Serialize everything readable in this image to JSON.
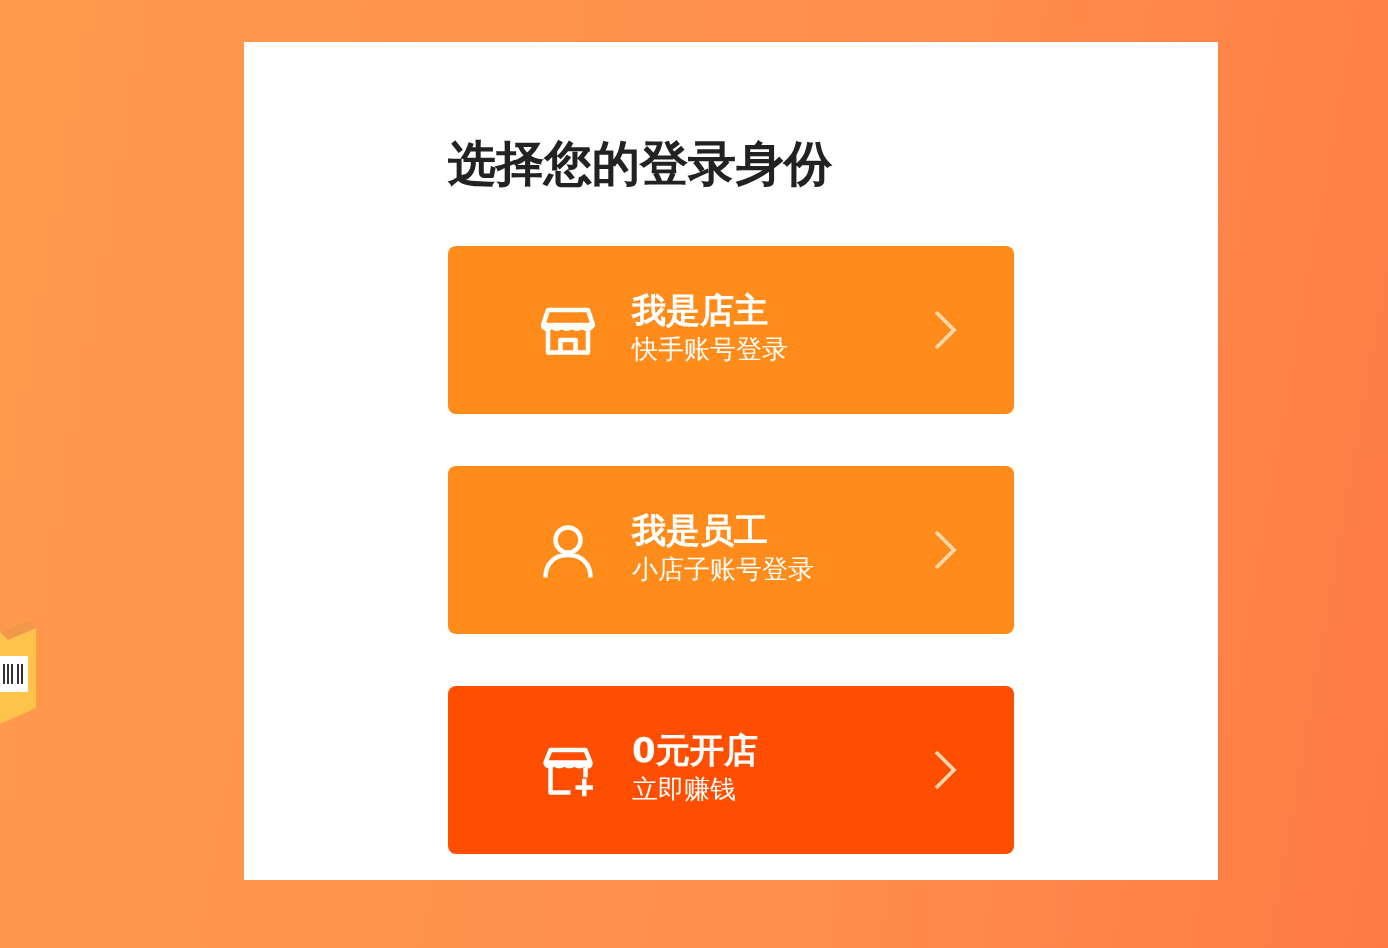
{
  "title": "选择您的登录身份",
  "options": [
    {
      "kind": "shop",
      "title": "我是店主",
      "subtitle": "快手账号登录",
      "color": "#ff8c1a"
    },
    {
      "kind": "person",
      "title": "我是员工",
      "subtitle": "小店子账号登录",
      "color": "#ff8c1a"
    },
    {
      "kind": "newshop",
      "title": "0元开店",
      "subtitle": "立即赚钱",
      "color": "#ff4e00"
    }
  ]
}
